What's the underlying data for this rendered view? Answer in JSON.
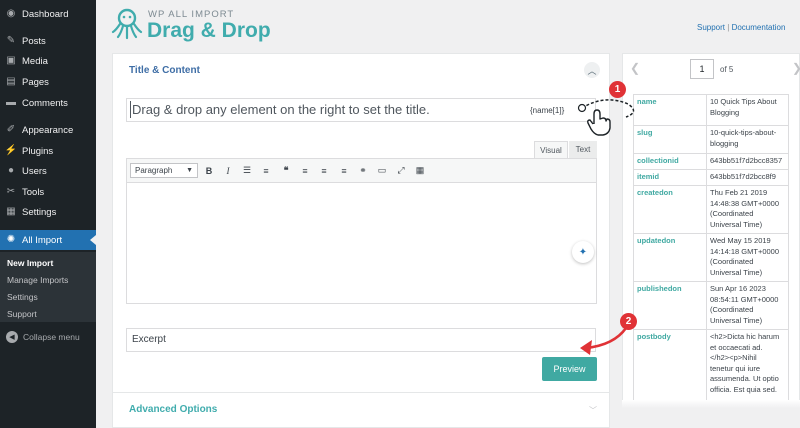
{
  "sidebar": {
    "items": [
      {
        "label": "Dashboard",
        "icon": "dashboard-icon",
        "glyph": "◉"
      },
      {
        "label": "Posts",
        "icon": "pin-icon",
        "glyph": "✎"
      },
      {
        "label": "Media",
        "icon": "media-icon",
        "glyph": "▣"
      },
      {
        "label": "Pages",
        "icon": "pages-icon",
        "glyph": "▤"
      },
      {
        "label": "Comments",
        "icon": "comments-icon",
        "glyph": "▬"
      },
      {
        "label": "Appearance",
        "icon": "brush-icon",
        "glyph": "✐"
      },
      {
        "label": "Plugins",
        "icon": "plug-icon",
        "glyph": "⚡"
      },
      {
        "label": "Users",
        "icon": "users-icon",
        "glyph": "●"
      },
      {
        "label": "Tools",
        "icon": "wrench-icon",
        "glyph": "✂"
      },
      {
        "label": "Settings",
        "icon": "settings-icon",
        "glyph": "▦"
      },
      {
        "label": "All Import",
        "icon": "octopus-icon",
        "glyph": "✺"
      }
    ],
    "submenu": [
      "New Import",
      "Manage Imports",
      "Settings",
      "Support"
    ],
    "collapse_label": "Collapse menu"
  },
  "header": {
    "brand_top": "WP ALL IMPORT",
    "brand_main": "Drag & Drop",
    "support": "Support",
    "separator": "|",
    "documentation": "Documentation"
  },
  "title_content": {
    "section_title": "Title & Content",
    "title_placeholder": "Drag & drop any element on the right to set the title.",
    "name_tag": "{name[1]}",
    "tab_visual": "Visual",
    "tab_text": "Text",
    "format_selected": "Paragraph",
    "excerpt": "Excerpt",
    "preview_label": "Preview",
    "advanced_label": "Advanced Options"
  },
  "colors": {
    "accent": "#40acad",
    "wp_blue": "#2271b1",
    "badge_red": "#e03236"
  },
  "record_nav": {
    "current_page": "1",
    "of_label": "of 5"
  },
  "xml_rows": [
    {
      "key": "name",
      "value": "10 Quick Tips About\nBlogging"
    },
    {
      "key": "slug",
      "value": "10-quick-tips-about-\nblogging"
    },
    {
      "key": "collectionid",
      "value": "643bb51f7d2bcc8357"
    },
    {
      "key": "itemid",
      "value": "643bb51f7d2bcc8f9"
    },
    {
      "key": "createdon",
      "value": "Thu Feb 21 2019\n14:48:38 GMT+0000\n(Coordinated\nUniversal Time)"
    },
    {
      "key": "updatedon",
      "value": "Wed May 15 2019\n14:14:18 GMT+0000\n(Coordinated\nUniversal Time)"
    },
    {
      "key": "publishedon",
      "value": "Sun Apr 16 2023\n08:54:11 GMT+0000\n(Coordinated\nUniversal Time)"
    },
    {
      "key": "postbody",
      "value": "<h2>Dicta hic harum\net occaecati ad.\n</h2><p>Nihil\ntenetur qui iure\nassumenda. Ut optio\nofficia. Est quia sed."
    }
  ],
  "annotations": {
    "step_one": "1",
    "step_two": "2"
  }
}
